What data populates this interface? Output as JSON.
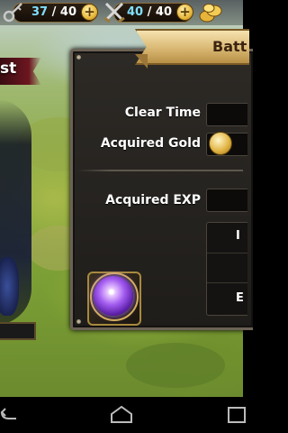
{
  "top_bar": {
    "stamina": {
      "current": "37",
      "separator": " / ",
      "max": "40",
      "icon": "key-icon"
    },
    "battle_points": {
      "current": "40",
      "separator": " / ",
      "max": "40",
      "icon": "crossed-swords-icon"
    },
    "plus_label": "+",
    "currency_icon": "gold-coins-icon"
  },
  "left_overlay": {
    "banner_text": "st"
  },
  "result_panel": {
    "title": "Batt",
    "rows": {
      "clear_time_label": "Clear Time",
      "acquired_gold_label": "Acquired Gold",
      "acquired_exp_label": "Acquired EXP"
    },
    "reward_letters": [
      "I",
      "",
      "E"
    ],
    "reward_icon": "purple-orb-icon"
  },
  "colors": {
    "accent_gold": "#d9b873",
    "panel_bg": "#2d2a26",
    "stat_current": "#7fe0ff"
  }
}
